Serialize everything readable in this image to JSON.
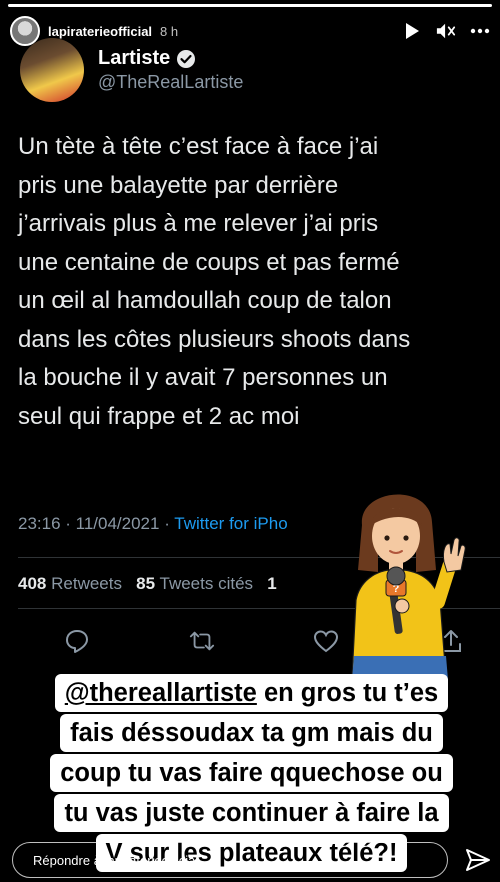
{
  "story": {
    "progress": 1.0,
    "username": "lapiraterieofficial",
    "time_ago": "8 h",
    "icons": [
      "play-icon",
      "mute-icon",
      "more-icon"
    ]
  },
  "tweet": {
    "author_name": "Lartiste",
    "author_handle": "@TheRealLartiste",
    "verified": true,
    "text": "Un tète à tête c’est face à face j’ai\npris une balayette par derrière\nj’arrivais plus à me relever j’ai pris\nune centaine de coups et pas fermé\nun œil al hamdoullah coup de talon\ndans les côtes plusieurs shoots dans\nla bouche il y avait 7 personnes un\nseul qui frappe et 2 ac moi",
    "timestamp": "23:16 · 11/04/2021 · ",
    "source": "Twitter for iPho",
    "retweets_count": "408",
    "retweets_label": "Retweets",
    "quotes_count": "85",
    "quotes_label": "Tweets cités",
    "likes_count_partial": "1",
    "action_icons": [
      "reply-icon",
      "retweet-icon",
      "like-icon",
      "share-icon"
    ]
  },
  "caption": {
    "mention": "@thereallartiste",
    "line1_rest": " en gros tu t’es",
    "line2": "fais déssoudax ta gm mais du",
    "line3": "coup tu vas faire qquechose ou",
    "line4": "tu vas juste continuer à faire la",
    "line5": "V sur les plateaux télé?!"
  },
  "reply": {
    "placeholder": "Répondre à lapiraterieofficial..."
  },
  "colors": {
    "background": "#000000",
    "link_blue": "#1d9bf0",
    "muted_gray": "#8b98a5",
    "sticker_jacket": "#f2c318"
  }
}
